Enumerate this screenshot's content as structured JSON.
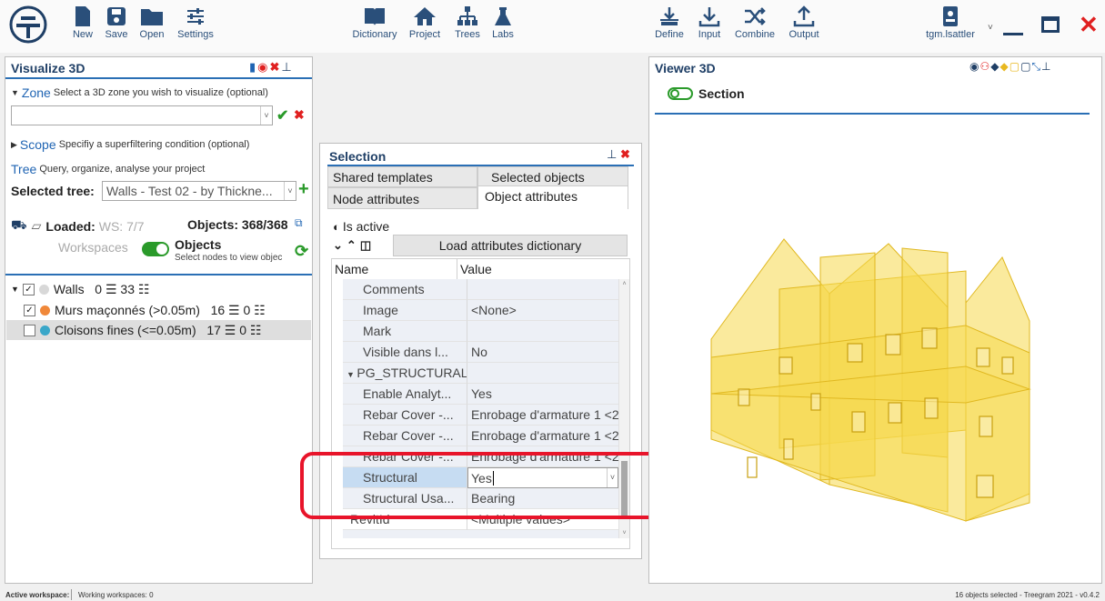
{
  "toolbar": {
    "left": [
      {
        "label": "New"
      },
      {
        "label": "Save"
      },
      {
        "label": "Open"
      },
      {
        "label": "Settings"
      }
    ],
    "center": [
      {
        "label": "Dictionary"
      },
      {
        "label": "Project"
      },
      {
        "label": "Trees"
      },
      {
        "label": "Labs"
      }
    ],
    "right": [
      {
        "label": "Define"
      },
      {
        "label": "Input"
      },
      {
        "label": "Combine"
      },
      {
        "label": "Output"
      }
    ],
    "user": "tgm.lsattler"
  },
  "visualize": {
    "title": "Visualize 3D",
    "zone_label": "Zone",
    "zone_desc": "Select a 3D zone you wish to visualize (optional)",
    "zone_value": "",
    "scope_label": "Scope",
    "scope_desc": "Specifiy a superfiltering condition (optional)",
    "tree_label": "Tree",
    "tree_desc": "Query, organize, analyse your project",
    "selected_tree_label": "Selected tree:",
    "selected_tree_value": "Walls - Test 02 - by Thickne...",
    "loaded_label": "Loaded:",
    "loaded_value": "WS: 7/7",
    "objects_count": "Objects: 368/368",
    "workspaces_label": "Workspaces",
    "objects_toggle_label": "Objects",
    "objects_toggle_hint": "Select nodes to view objec",
    "tree": [
      {
        "name": "Walls",
        "counts": "0 ☰ 33 ☷",
        "color": "#d8d8d8",
        "checked": true
      },
      {
        "name": "Murs maçonnés (>0.05m)",
        "counts": "16 ☰ 0 ☷",
        "color": "#f0883a",
        "checked": true
      },
      {
        "name": "Cloisons fines (<=0.05m)",
        "counts": "17 ☰ 0 ☷",
        "color": "#3aa7c9",
        "checked": false
      }
    ]
  },
  "selection": {
    "title": "Selection",
    "tabs": [
      "Shared templates",
      "Selected objects",
      "Node attributes",
      "Object attributes"
    ],
    "is_active": "Is active",
    "load_dict": "Load attributes dictionary",
    "col_name": "Name",
    "col_value": "Value",
    "rows": [
      {
        "name": "Comments",
        "value": ""
      },
      {
        "name": "Image",
        "value": "<None>"
      },
      {
        "name": "Mark",
        "value": ""
      },
      {
        "name": "Visible dans l...",
        "value": "No"
      },
      {
        "name": "PG_STRUCTURAL",
        "value": ""
      },
      {
        "name": "Enable Analyt...",
        "value": "Yes"
      },
      {
        "name": "Rebar Cover -...",
        "value": "Enrobage d'armature 1 <2"
      },
      {
        "name": "Rebar Cover -...",
        "value": "Enrobage d'armature 1 <2"
      },
      {
        "name": "Rebar Cover -...",
        "value": "Enrobage d'armature 1 <2"
      },
      {
        "name": "Structural",
        "value": "Yes"
      },
      {
        "name": "Structural Usa...",
        "value": "Bearing"
      },
      {
        "name": "RevitId",
        "value": "<Multiple values>"
      }
    ]
  },
  "viewer": {
    "title": "Viewer 3D",
    "section": "Section"
  },
  "status": {
    "active_ws": "Active workspace:",
    "working_ws": "Working workspaces: 0",
    "right": "16 objects selected  -  Treegram 2021 - v0.4.2"
  },
  "colors": {
    "accent": "#1f64b3",
    "red": "#e02020",
    "green": "#2a9a2a",
    "highlight": "#e8142a",
    "wall": "#f5d94c"
  }
}
